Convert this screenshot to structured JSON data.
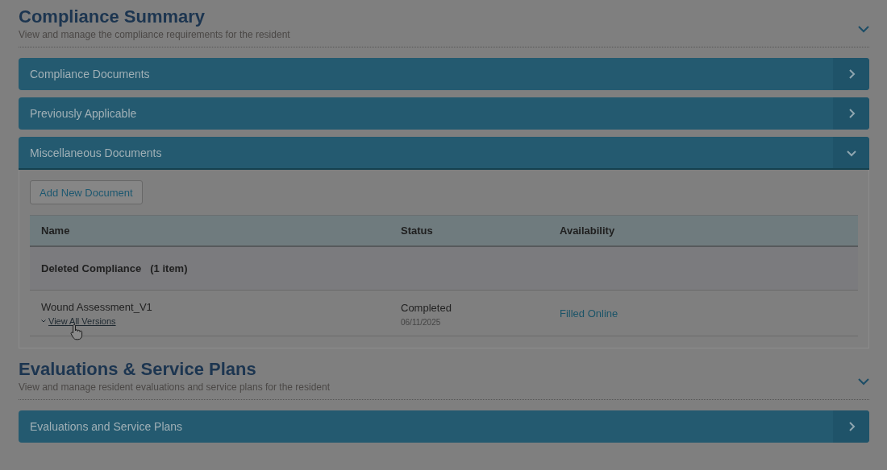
{
  "sections": [
    {
      "title": "Compliance Summary",
      "subtitle": "View and manage the compliance requirements for the resident",
      "expanded": true,
      "panels": [
        {
          "label": "Compliance Documents",
          "expanded": false
        },
        {
          "label": "Previously Applicable",
          "expanded": false
        },
        {
          "label": "Miscellaneous Documents",
          "expanded": true,
          "content": {
            "button": "Add New Document",
            "columns": [
              "Name",
              "Status",
              "Availability"
            ],
            "groups": [
              {
                "label": "Deleted Compliance",
                "count": "(1 item)",
                "rows": [
                  {
                    "name": "Wound Assessment_V1",
                    "link": "View All Versions",
                    "status": "Completed",
                    "date": "06/11/2025",
                    "availability": "Filled Online"
                  }
                ]
              }
            ]
          }
        }
      ]
    },
    {
      "title": "Evaluations & Service Plans",
      "subtitle": "View and manage resident evaluations and service plans for the resident",
      "expanded": true,
      "panels": [
        {
          "label": "Evaluations and Service Plans",
          "expanded": false
        }
      ]
    }
  ]
}
